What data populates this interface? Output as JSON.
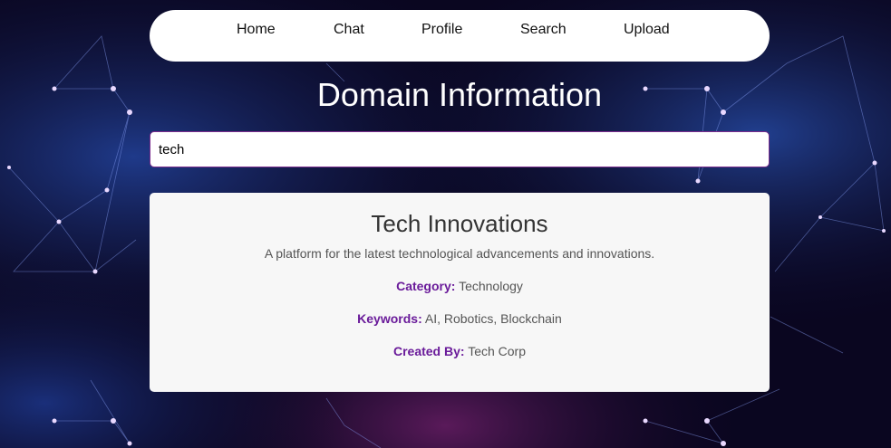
{
  "nav": {
    "items": [
      {
        "label": "Home"
      },
      {
        "label": "Chat"
      },
      {
        "label": "Profile"
      },
      {
        "label": "Search"
      },
      {
        "label": "Upload"
      }
    ]
  },
  "page": {
    "title": "Domain Information"
  },
  "search": {
    "value": "tech"
  },
  "domain": {
    "name": "Tech Innovations",
    "description": "A platform for the latest technological advancements and innovations.",
    "category_label": "Category:",
    "category": "Technology",
    "keywords_label": "Keywords:",
    "keywords": "AI, Robotics, Blockchain",
    "created_by_label": "Created By:",
    "created_by": "Tech Corp"
  },
  "colors": {
    "accent": "#6a1b9a",
    "card_bg": "#f7f7f7",
    "background": "#0a0620"
  }
}
